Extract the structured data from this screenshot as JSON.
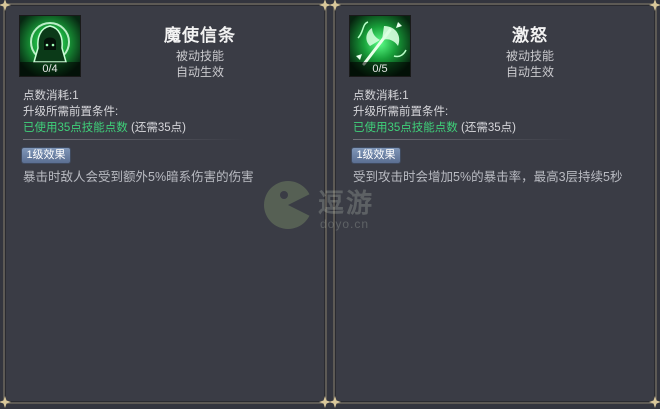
{
  "skills": [
    {
      "icon": "hooded-assassin-icon",
      "level_display": "0/4",
      "name": "魔使信条",
      "type": "被动技能",
      "effect_mode": "自动生效",
      "cost_label": "点数消耗:1",
      "req_title": "升级所需前置条件:",
      "req_met": "已使用35点技能点数",
      "req_note": "(还需35点)",
      "level_badge": "1级效果",
      "effect_desc": "暴击时敌人会受到额外5%暗系伤害的伤害"
    },
    {
      "icon": "rage-axe-icon",
      "level_display": "0/5",
      "name": "激怒",
      "type": "被动技能",
      "effect_mode": "自动生效",
      "cost_label": "点数消耗:1",
      "req_title": "升级所需前置条件:",
      "req_met": "已使用35点技能点数",
      "req_note": "(还需35点)",
      "level_badge": "1级效果",
      "effect_desc": "受到攻击时会增加5%的暴击率，最高3层持续5秒"
    }
  ],
  "watermark": {
    "logo_text": "逗游",
    "domain": "doyo.cn"
  },
  "colors": {
    "panel_bg": "#3a3c45",
    "panel_border": "#5d5a55",
    "requirement_met": "#3fd17a",
    "badge_blue": "#6c83a8",
    "icon_green": "#2fd35b"
  }
}
